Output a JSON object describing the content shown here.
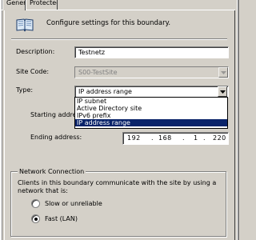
{
  "tabs": [
    {
      "label": "General",
      "active": true
    },
    {
      "label": "Protected",
      "active": false
    }
  ],
  "header": {
    "text": "Configure settings for this boundary.",
    "icon": "book-icon"
  },
  "fields": {
    "description": {
      "label": "Description:",
      "value": "Testnetz"
    },
    "site_code": {
      "label": "Site Code:",
      "value": "S00-TestSite"
    },
    "type": {
      "label": "Type:",
      "value": "IP address range"
    },
    "starting_address": {
      "label": "Starting address:"
    },
    "ending_address": {
      "label": "Ending address:",
      "octets": [
        "192",
        "168",
        "1",
        "220"
      ]
    }
  },
  "type_dropdown": {
    "options": [
      "IP subnet",
      "Active Directory site",
      "IPv6 prefix",
      "IP address range"
    ],
    "selected_index": 3
  },
  "network_connection": {
    "title": "Network Connection",
    "description": "Clients in this boundary communicate with the site by using a network that is:",
    "options": [
      {
        "label": "Slow or unreliable",
        "checked": false
      },
      {
        "label": "Fast (LAN)",
        "checked": true
      }
    ]
  },
  "colors": {
    "dialog_bg": "#d4d0c8",
    "selection": "#0a246a"
  }
}
